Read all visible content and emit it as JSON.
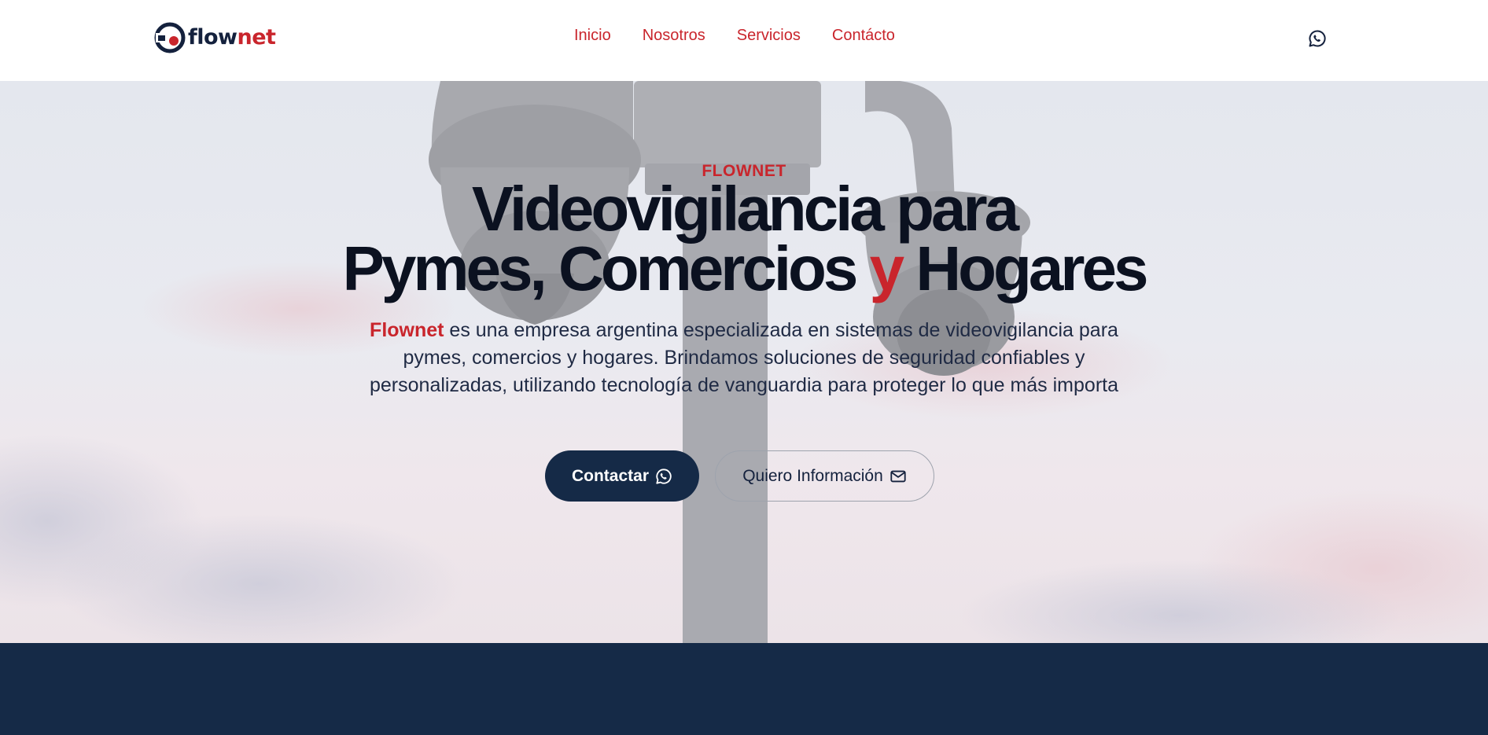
{
  "brand": {
    "name_part1": "flow",
    "name_part2": "net",
    "logo_icon": "camera-logo-icon"
  },
  "nav": {
    "items": [
      {
        "label": "Inicio"
      },
      {
        "label": "Nosotros"
      },
      {
        "label": "Servicios"
      },
      {
        "label": "Contácto"
      }
    ],
    "whatsapp_icon": "whatsapp-icon"
  },
  "hero": {
    "eyebrow": "FLOWNET",
    "headline_line1": "Videovigilancia para",
    "headline_line2_a": "Pymes, Comercios ",
    "headline_line2_accent": "y",
    "headline_line2_b": " Hogares",
    "desc_brand": "Flownet",
    "desc_text": " es una empresa argentina especializada en sistemas de videovigilancia para pymes, comercios y hogares. Brindamos soluciones de seguridad confiables y personalizadas, utilizando tecnología de vanguardia para proteger lo que más importa",
    "primary_button": "Contactar",
    "primary_button_icon": "whatsapp-icon",
    "secondary_button": "Quiero Información",
    "secondary_button_icon": "mail-icon"
  },
  "colors": {
    "accent": "#c9252c",
    "navy": "#152a47",
    "text_dark": "#0b1120"
  }
}
